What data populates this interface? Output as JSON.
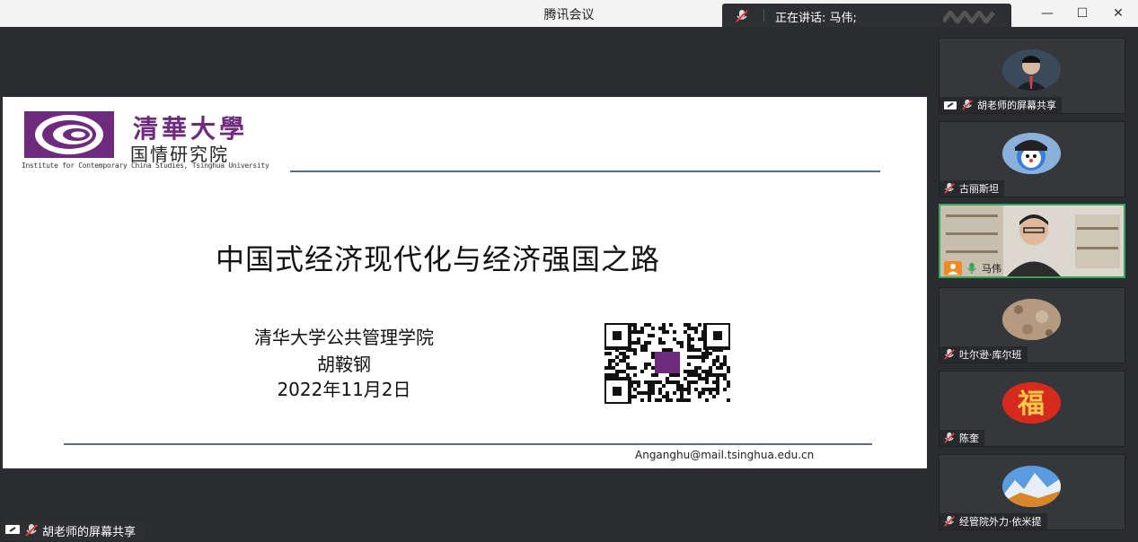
{
  "app": {
    "title": "腾讯会议"
  },
  "speaking": {
    "label": "正在讲话: 马伟;"
  },
  "window_controls": {
    "minimize": "—",
    "maximize": "☐",
    "close": "✕"
  },
  "slide": {
    "logo_cn_top": "清華大學",
    "logo_cn_bottom": "国情研究院",
    "logo_en": "Institute for Contemporary China Studies, Tsinghua University",
    "title": "中国式经济现代化与经济强国之路",
    "school": "清华大学公共管理学院",
    "author": "胡鞍钢",
    "date": "2022年11月2日",
    "email": "Anganghu@mail.tsinghua.edu.cn"
  },
  "share_label": "胡老师的屏幕共享",
  "participants": [
    {
      "name": "胡老师的屏幕共享",
      "screen_share": true,
      "muted": true
    },
    {
      "name": "古丽斯坦",
      "muted": true
    },
    {
      "name": "马伟",
      "speaking": true
    },
    {
      "name": "吐尔逊·库尔班",
      "muted": true
    },
    {
      "name": "陈奎",
      "muted": true
    },
    {
      "name": "经管院外力·依米提",
      "muted": true
    }
  ],
  "colors": {
    "brand_purple": "#6e2a7c",
    "active_border": "#3aa35a",
    "background": "#2b2c2f"
  }
}
